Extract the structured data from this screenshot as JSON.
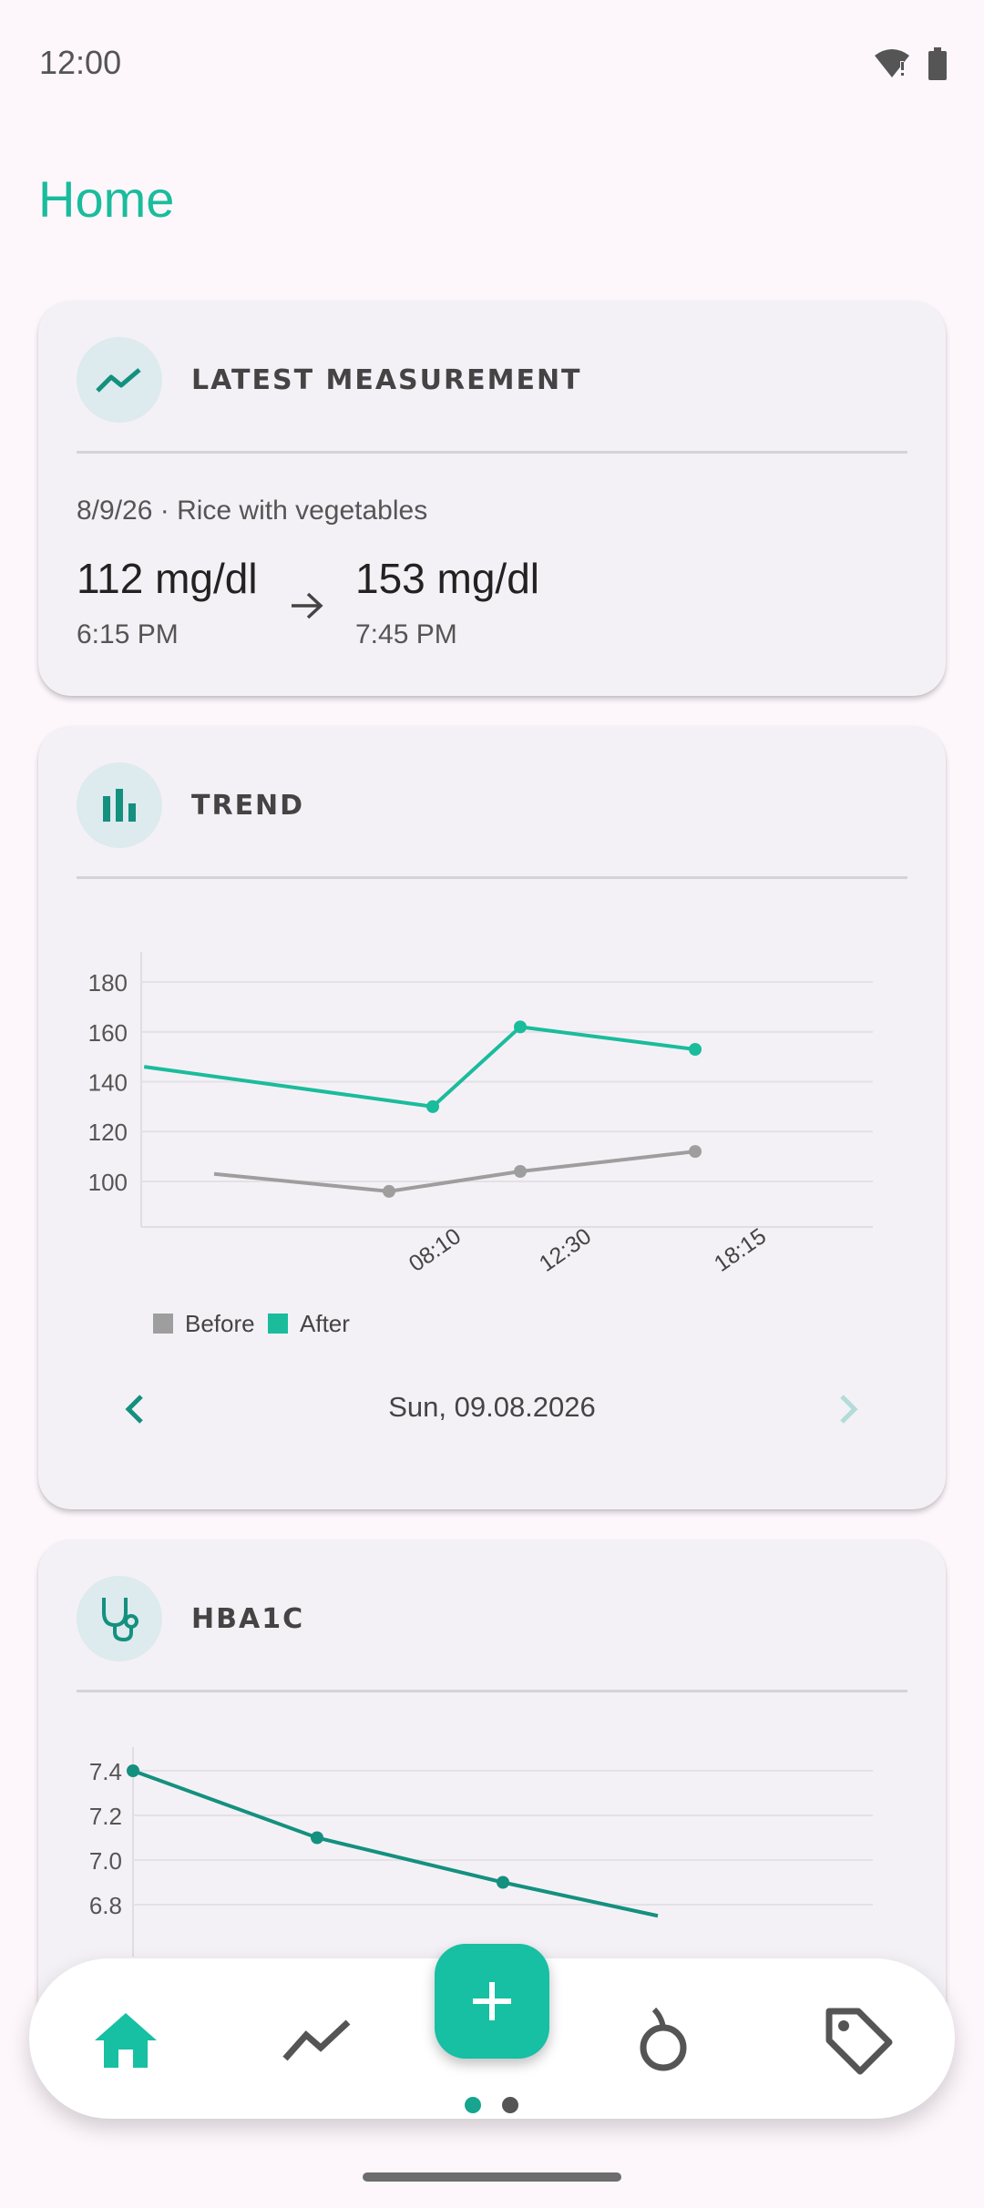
{
  "status": {
    "time": "12:00"
  },
  "page": {
    "title": "Home"
  },
  "latest": {
    "title": "LATEST MEASUREMENT",
    "meal": "8/9/26 · Rice with vegetables",
    "before_value": "112 mg/dl",
    "before_time": "6:15 PM",
    "after_value": "153 mg/dl",
    "after_time": "7:45 PM"
  },
  "trend": {
    "title": "TREND",
    "date": "Sun, 09.08.2026"
  },
  "hba1c": {
    "title": "HBA1C"
  },
  "colors": {
    "accent": "#1abc9c",
    "teal_dark": "#14907f",
    "grey": "#9e9e9e"
  },
  "chart_data": [
    {
      "type": "line",
      "x": [
        "08:10",
        "12:30",
        "18:15"
      ],
      "y_ticks": [
        100,
        120,
        140,
        160,
        180
      ],
      "series": [
        {
          "name": "Before",
          "color": "#9e9e9e",
          "points": [
            [
              -1,
              103
            ],
            [
              0,
              96
            ],
            [
              0.75,
              104
            ],
            [
              1.75,
              112
            ]
          ]
        },
        {
          "name": "After",
          "color": "#1abc9c",
          "points": [
            [
              -1.4,
              146
            ],
            [
              0.25,
              130
            ],
            [
              0.75,
              162
            ],
            [
              1.75,
              153
            ]
          ]
        }
      ],
      "legend": [
        "Before",
        "After"
      ],
      "legend_position": "bottom-left"
    },
    {
      "type": "line",
      "y_ticks": [
        "7.4",
        "7.2",
        "7.0",
        "6.8"
      ],
      "series": [
        {
          "color": "#14907f",
          "values": [
            7.4,
            7.1,
            6.9,
            6.75
          ]
        }
      ]
    }
  ],
  "nav": {
    "items": [
      "home-icon",
      "trend-icon",
      "add-icon",
      "food-icon",
      "tag-icon"
    ]
  }
}
